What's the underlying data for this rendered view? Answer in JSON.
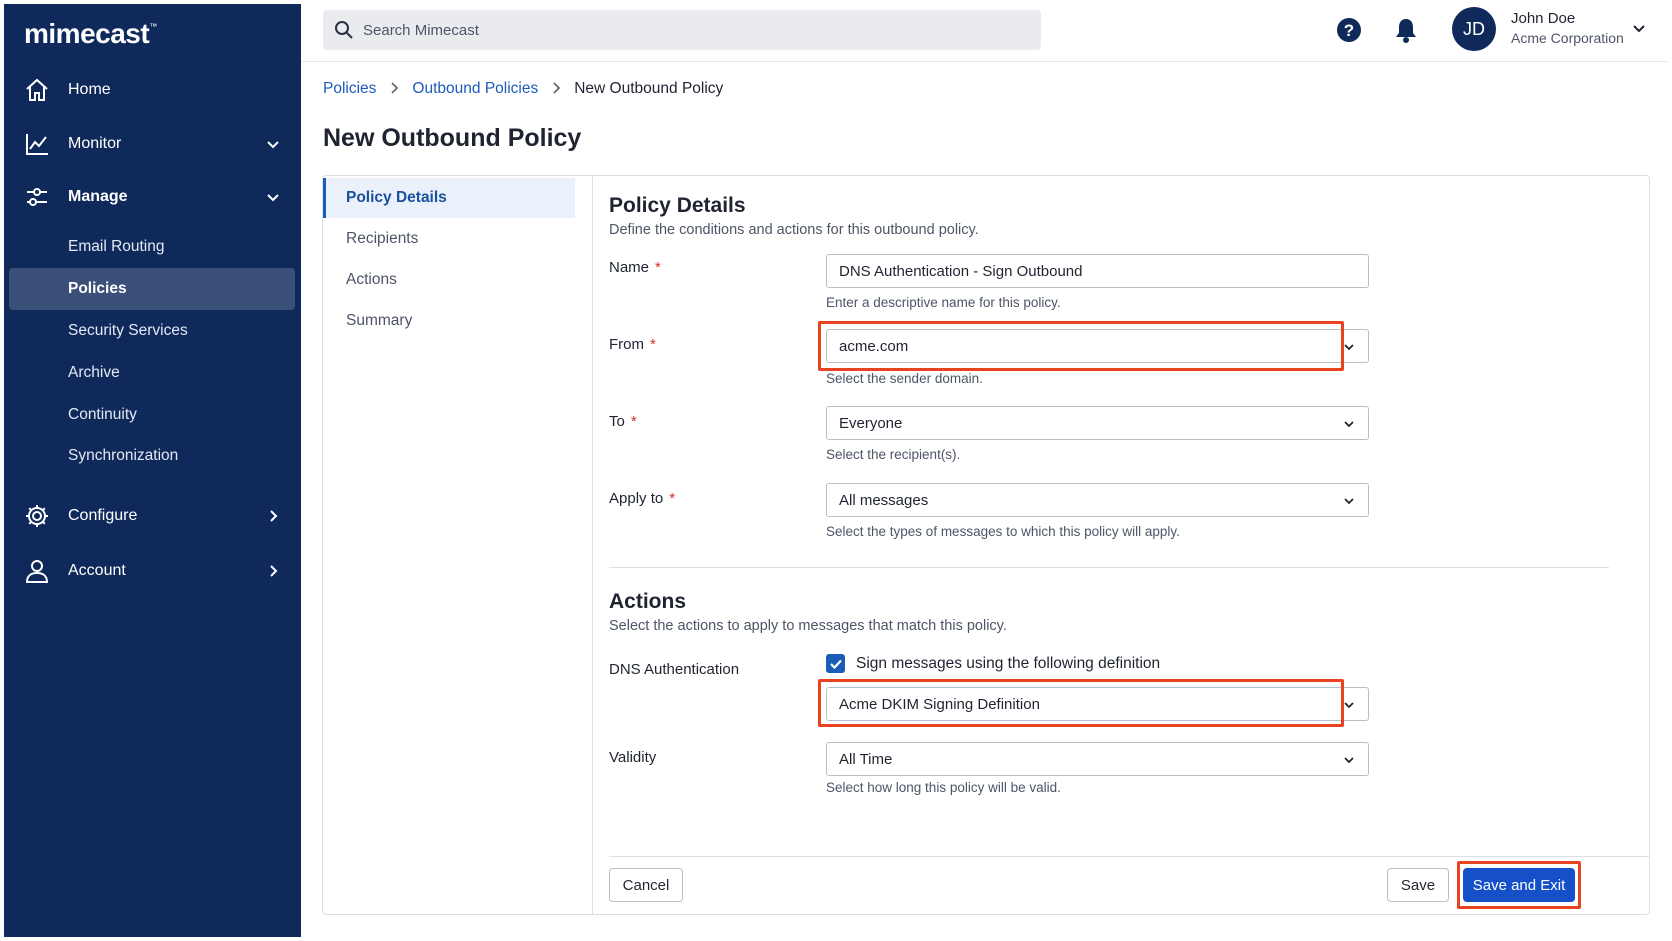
{
  "brand": {
    "name": "mimecast",
    "trademark": "™"
  },
  "sidebar": {
    "items": [
      {
        "label": "Home",
        "icon": "home-icon"
      },
      {
        "label": "Monitor",
        "icon": "chart-icon"
      },
      {
        "label": "Manage",
        "icon": "sliders-icon"
      },
      {
        "label": "Configure",
        "icon": "gear-icon"
      },
      {
        "label": "Account",
        "icon": "user-icon"
      }
    ],
    "manage_sub": [
      {
        "label": "Email Routing"
      },
      {
        "label": "Policies",
        "active": true
      },
      {
        "label": "Security Services"
      },
      {
        "label": "Archive"
      },
      {
        "label": "Continuity"
      },
      {
        "label": "Synchronization"
      }
    ]
  },
  "topbar": {
    "search_placeholder": "Search Mimecast",
    "user": {
      "initials": "JD",
      "name": "John Doe",
      "org": "Acme Corporation"
    }
  },
  "breadcrumb": [
    "Policies",
    "Outbound Policies",
    "New Outbound Policy"
  ],
  "page_title": "New Outbound Policy",
  "steps": [
    "Policy Details",
    "Recipients",
    "Actions",
    "Summary"
  ],
  "policy_details": {
    "title": "Policy Details",
    "description": "Define the conditions and actions for this outbound policy.",
    "name": {
      "label": "Name",
      "value": "DNS Authentication - Sign Outbound",
      "help": "Enter a descriptive name for this policy."
    },
    "from": {
      "label": "From",
      "value": "acme.com",
      "help": "Select the sender domain."
    },
    "to": {
      "label": "To",
      "value": "Everyone",
      "help": "Select the recipient(s)."
    },
    "apply_to": {
      "label": "Apply to",
      "value": "All messages",
      "help": "Select the types of messages to which this policy will apply."
    }
  },
  "actions": {
    "title": "Actions",
    "description": "Select the actions to apply to messages that match this policy.",
    "dns_auth": {
      "label": "DNS Authentication",
      "checkbox_label": "Sign messages using the following definition",
      "checked": true,
      "value": "Acme DKIM Signing Definition"
    },
    "validity": {
      "label": "Validity",
      "value": "All Time",
      "help": "Select how long this policy will be valid."
    }
  },
  "buttons": {
    "cancel": "Cancel",
    "save": "Save",
    "save_exit": "Save and Exit"
  },
  "required_mark": "*",
  "colors": {
    "sidebar_bg": "#0f2a5a",
    "primary": "#1550c9",
    "link": "#1a5cb8",
    "highlight": "#e8431f",
    "required": "#d93025"
  }
}
